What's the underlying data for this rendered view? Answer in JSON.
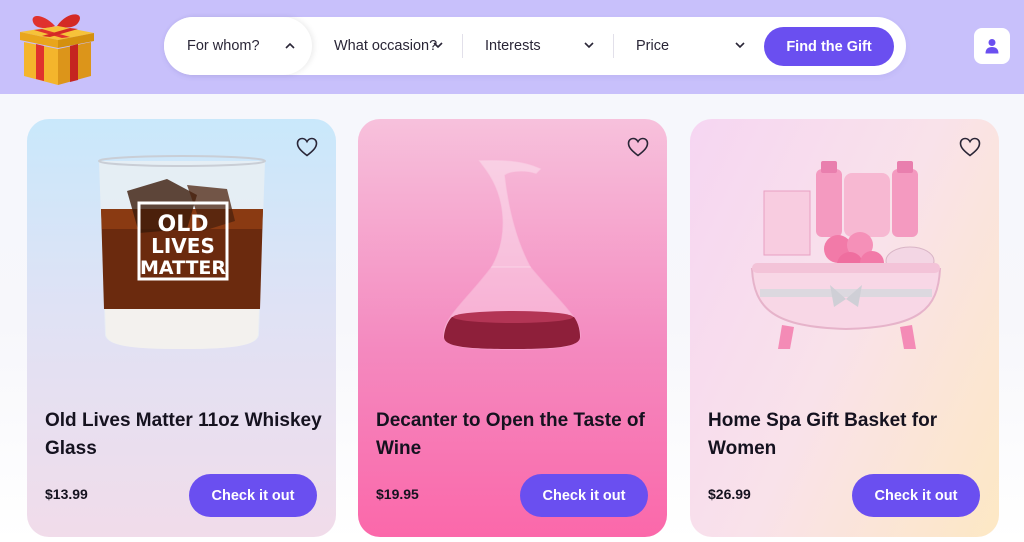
{
  "header": {
    "logo_icon": "gift-box-icon",
    "filters": [
      {
        "label": "For whom?",
        "icon": "chevron-up-icon"
      },
      {
        "label": "What occasion?",
        "icon": "chevron-down-icon"
      },
      {
        "label": "Interests",
        "icon": "chevron-down-icon"
      },
      {
        "label": "Price",
        "icon": "chevron-down-icon"
      }
    ],
    "find_button": "Find the Gift",
    "user_icon": "user-icon"
  },
  "products": [
    {
      "title": "Old Lives Matter 11oz Whiskey Glass",
      "price": "$13.99",
      "button": "Check it out",
      "glass_text": [
        "OLD",
        "LIVES",
        "MATTER"
      ]
    },
    {
      "title": "Decanter to Open the Taste of Wine",
      "price": "$19.95",
      "button": "Check it out"
    },
    {
      "title": "Home Spa Gift Basket for Women",
      "price": "$26.99",
      "button": "Check it out"
    }
  ],
  "colors": {
    "accent": "#6a4ff0",
    "header_bg": "#c8c0fb"
  }
}
